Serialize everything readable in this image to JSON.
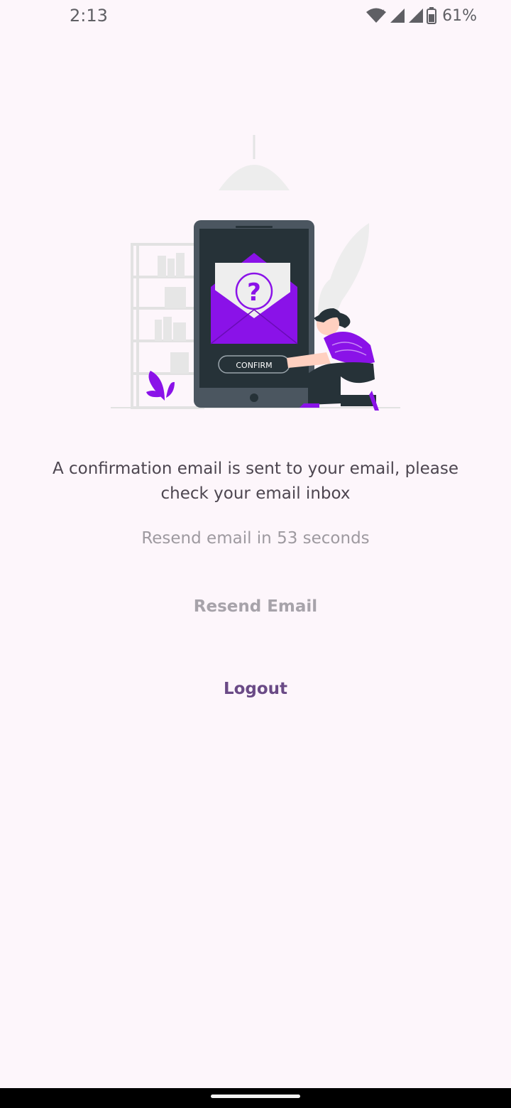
{
  "status_bar": {
    "time": "2:13",
    "battery_percent": "61%",
    "icons": [
      "wifi-icon",
      "signal-icon",
      "battery-icon"
    ]
  },
  "illustration": {
    "button_label": "CONFIRM",
    "icon": "question-mark-icon",
    "accent_color": "#8a12e8"
  },
  "message": "A confirmation email is sent to your email, please check your email inbox",
  "countdown": "Resend email in 53 seconds",
  "actions": {
    "resend_label": "Resend Email",
    "logout_label": "Logout"
  },
  "colors": {
    "background": "#fdf6fb",
    "primary": "#6a4a86",
    "disabled": "#a7a3aa"
  }
}
